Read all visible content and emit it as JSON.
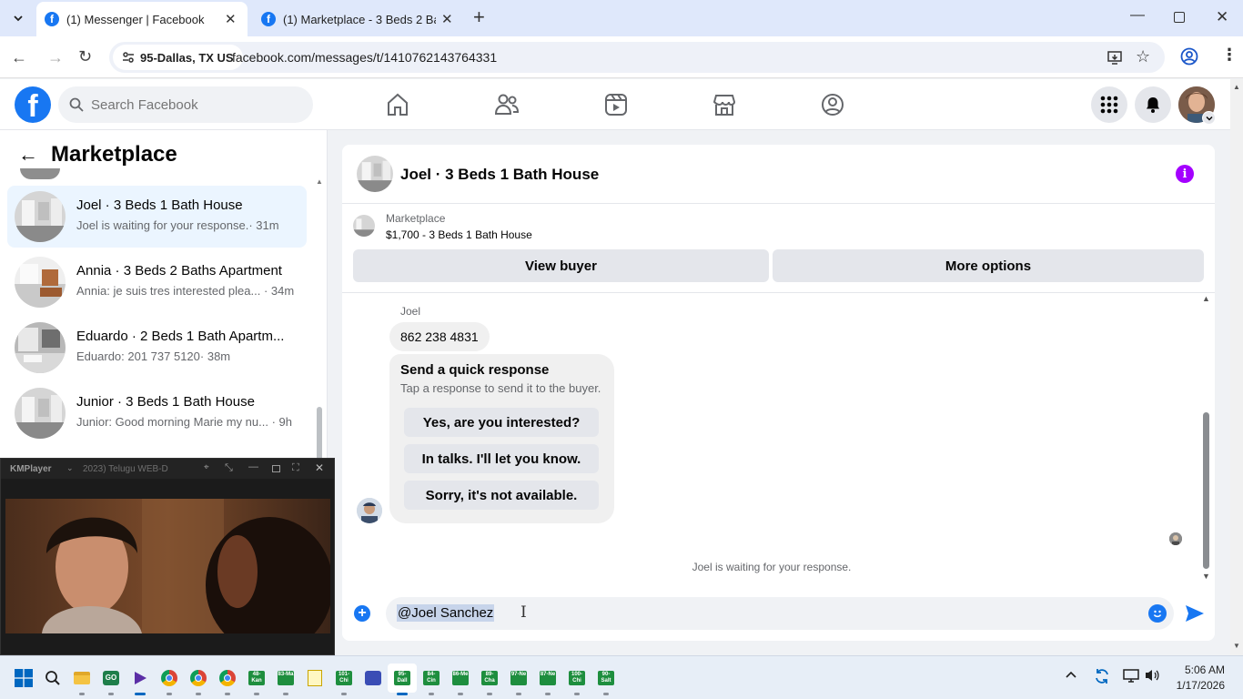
{
  "browser": {
    "tabs": [
      {
        "title": "(1) Messenger | Facebook",
        "active": true
      },
      {
        "title": "(1) Marketplace - 3 Beds 2 Bath",
        "active": false
      }
    ],
    "site_chip": "95-Dallas, TX US",
    "url": "facebook.com/messages/t/1410762143764331"
  },
  "fb": {
    "search_placeholder": "Search Facebook",
    "brand_color": "#1877f2"
  },
  "sidebar": {
    "title": "Marketplace",
    "conversations": [
      {
        "title": "Joel · 3 Beds 1 Bath House",
        "snippet": "Joel is waiting for your response.",
        "time": "· 31m",
        "selected": true
      },
      {
        "title": "Annia · 3 Beds 2 Baths Apartment",
        "snippet": "Annia: je suis tres interested plea...",
        "time": "· 34m",
        "selected": false
      },
      {
        "title": "Eduardo · 2 Beds 1 Bath Apartm...",
        "snippet": "Eduardo: 201 737 5120",
        "time": "· 38m",
        "selected": false
      },
      {
        "title": "Junior · 3 Beds 1 Bath House",
        "snippet": "Junior: Good morning Marie my nu...",
        "time": "· 9h",
        "selected": false
      }
    ]
  },
  "chat": {
    "title": "Joel · 3 Beds 1 Bath House",
    "listing_source": "Marketplace",
    "listing": "$1,700 - 3 Beds 1 Bath House",
    "view_buyer": "View buyer",
    "more_options": "More options",
    "sender": "Joel",
    "message": "862 238 4831",
    "quick_title": "Send a quick response",
    "quick_sub": "Tap a response to send it to the buyer.",
    "quick_responses": [
      "Yes, are you interested?",
      "In talks. I'll let you know.",
      "Sorry, it's not available."
    ],
    "waiting": "Joel is waiting for your response.",
    "composer_value": "@Joel Sanchez"
  },
  "kmplayer": {
    "app": "KMPlayer",
    "title": "2023) Telugu WEB-D"
  },
  "taskbar": {
    "time": "5:06 AM",
    "date": "1/17/2026",
    "sheet_labels": [
      "48-Kan",
      "83-Ma",
      "101-Chi",
      "95-Dall",
      "84-Cin",
      "86-Me",
      "89-Cha",
      "97-Ne",
      "87-Ne",
      "100-Chi",
      "90-Salt"
    ]
  }
}
